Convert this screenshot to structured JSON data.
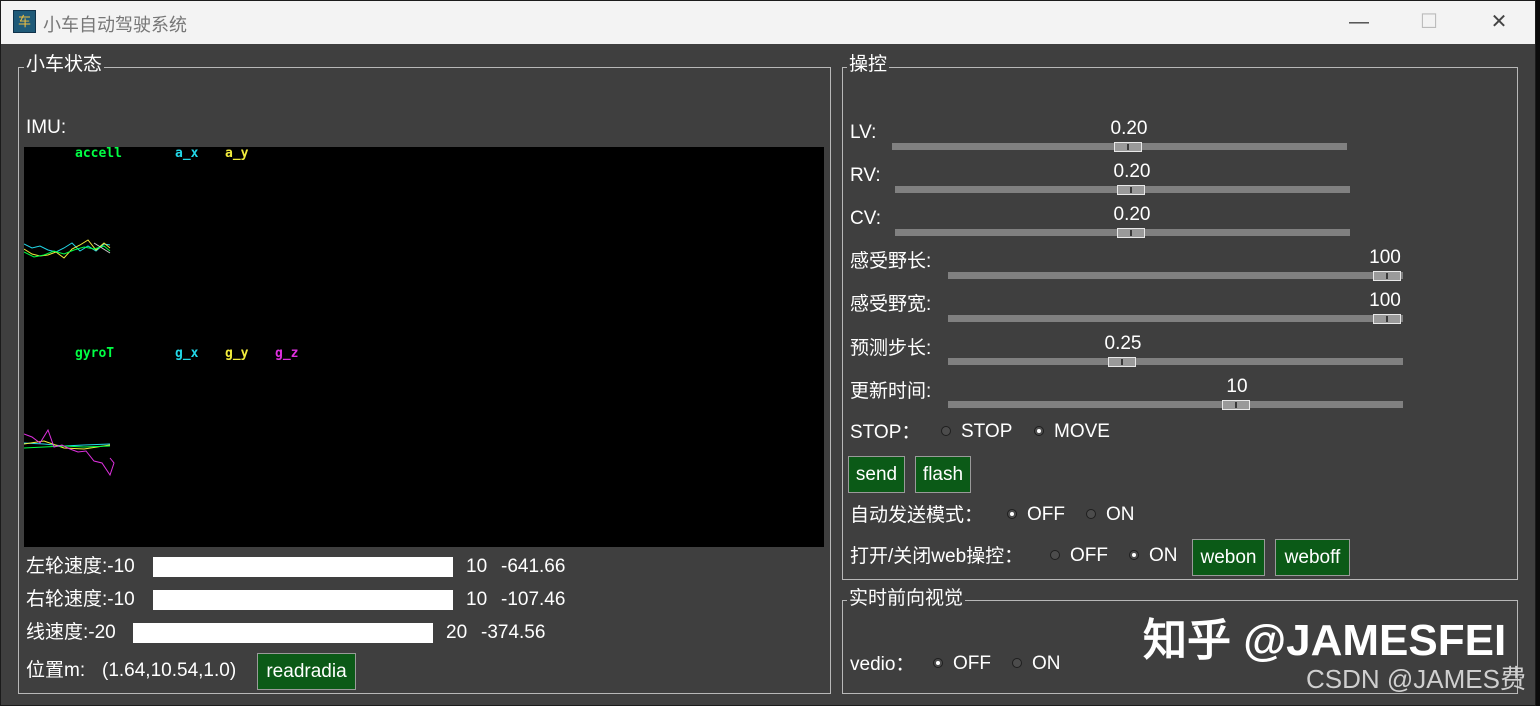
{
  "window": {
    "title": "小车自动驾驶系统",
    "minimize": "—",
    "maximize": "☐",
    "close": "✕"
  },
  "status": {
    "frame_title": "小车状态",
    "imu_label": "IMU:",
    "accel_labels": [
      "accell",
      "a_x",
      "a_y"
    ],
    "gyro_labels": [
      "gyroT",
      "g_x",
      "g_y",
      "g_z"
    ],
    "left_wheel": {
      "label": "左轮速度:-10",
      "fill": 1.0,
      "max": "10",
      "value": "-641.66"
    },
    "right_wheel": {
      "label": "右轮速度:-10",
      "fill": 1.0,
      "max": "10",
      "value": "-107.46"
    },
    "linear": {
      "label": "线速度:-20",
      "fill": 1.0,
      "max": "20",
      "value": "-374.56"
    },
    "position_label": "位置m:",
    "position_value": "(1.64,10.54,1.0)",
    "readradia": "readradia"
  },
  "control": {
    "frame_title": "操控",
    "sliders": [
      {
        "label": "LV:",
        "value": "0.20"
      },
      {
        "label": "RV:",
        "value": "0.20"
      },
      {
        "label": "CV:",
        "value": "0.20"
      },
      {
        "label": "感受野长:",
        "value": "100"
      },
      {
        "label": "感受野宽:",
        "value": "100"
      },
      {
        "label": "预测步长:",
        "value": "0.25"
      },
      {
        "label": "更新时间:",
        "value": "10"
      }
    ],
    "stop_label": "STOP：",
    "stop_opt": "STOP",
    "move_opt": "MOVE",
    "send": "send",
    "flash": "flash",
    "auto_label": "自动发送模式：",
    "auto_off": "OFF",
    "auto_on": "ON",
    "web_label": "打开/关闭web操控：",
    "web_off": "OFF",
    "web_on": "ON",
    "webon": "webon",
    "weboff": "weboff"
  },
  "vision": {
    "frame_title": "实时前向视觉",
    "vedio_label": "vedio：",
    "off": "OFF",
    "on": "ON"
  },
  "watermark": {
    "zhihu": "知乎 @JAMESFEI",
    "csdn": "CSDN @JAMES费"
  },
  "colors": {
    "background": "#3f3f3f",
    "button": "#0b5a17",
    "accel": "#00ff44",
    "cyan": "#22d8e8",
    "yellow": "#f2ec3c",
    "magenta": "#e030e0"
  }
}
